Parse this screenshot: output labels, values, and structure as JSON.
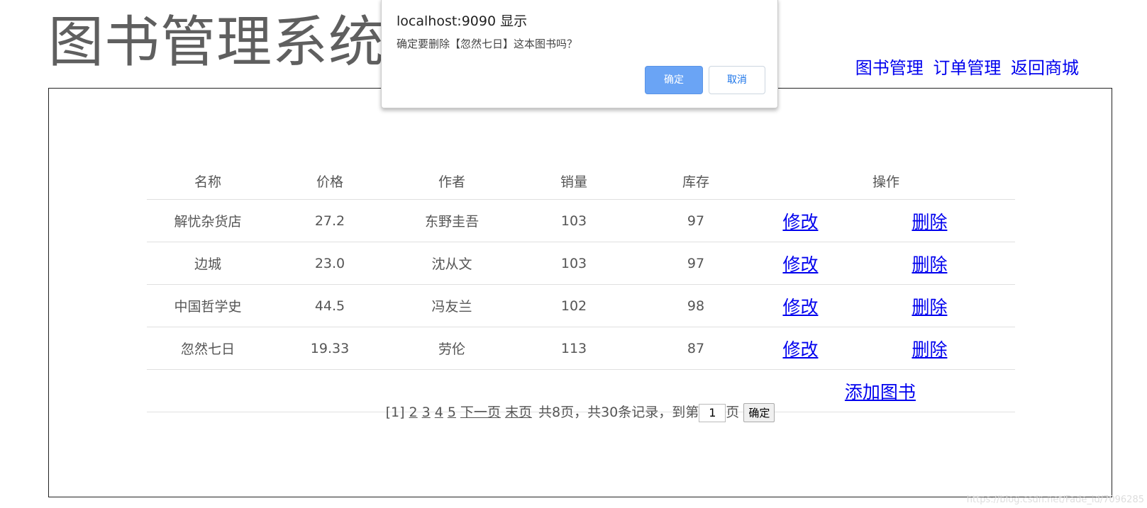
{
  "header": {
    "logo_text": "图书管理系统",
    "nav": [
      "图书管理",
      "订单管理",
      "返回商城"
    ]
  },
  "table": {
    "columns": [
      "名称",
      "价格",
      "作者",
      "销量",
      "库存",
      "操作"
    ],
    "rows": [
      {
        "name": "解忧杂货店",
        "price": "27.2",
        "author": "东野圭吾",
        "sales": "103",
        "stock": "97",
        "edit": "修改",
        "delete": "删除"
      },
      {
        "name": "边城",
        "price": "23.0",
        "author": "沈从文",
        "sales": "103",
        "stock": "97",
        "edit": "修改",
        "delete": "删除"
      },
      {
        "name": "中国哲学史",
        "price": "44.5",
        "author": "冯友兰",
        "sales": "102",
        "stock": "98",
        "edit": "修改",
        "delete": "删除"
      },
      {
        "name": "忽然七日",
        "price": "19.33",
        "author": "劳伦",
        "sales": "113",
        "stock": "87",
        "edit": "修改",
        "delete": "删除"
      }
    ],
    "add_label": "添加图书"
  },
  "pager": {
    "current": "[1]",
    "pages": [
      "2",
      "3",
      "4",
      "5"
    ],
    "next_label": "下一页",
    "last_label": "末页",
    "summary": "共8页，共30条记录，到第",
    "input_value": "1",
    "page_suffix": "页",
    "go_label": "确定"
  },
  "dialog": {
    "title": "localhost:9090 显示",
    "message": "确定要删除【忽然七日】这本图书吗？",
    "ok_label": "确定",
    "cancel_label": "取消"
  },
  "colors": {
    "link": "#0000ee",
    "ok_button": "#6aa4f5",
    "cancel_text": "#1a73e8"
  },
  "watermark": "https://blog.csdn.net/Fade_id/7096285"
}
